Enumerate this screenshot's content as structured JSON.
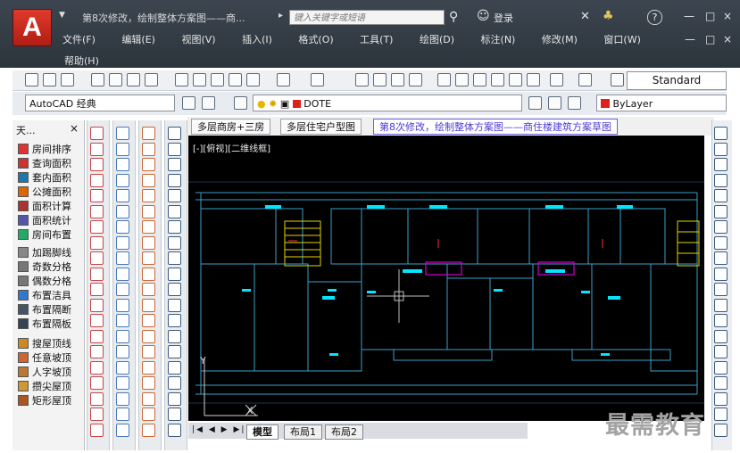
{
  "app": {
    "logo_letter": "A",
    "document_title": "第8次修改，绘制整体方案图——商...",
    "title_arrow": "▸",
    "search_placeholder": "键入关键字或短语",
    "login_label": "登录",
    "help_symbol": "?",
    "window_controls": [
      "—",
      "□",
      "×"
    ],
    "doc_controls": [
      "—",
      "□",
      "×"
    ]
  },
  "menu": {
    "items": [
      "文件(F)",
      "编辑(E)",
      "视图(V)",
      "插入(I)",
      "格式(O)",
      "工具(T)",
      "绘图(D)",
      "标注(N)",
      "修改(M)",
      "窗口(W)"
    ],
    "help": "帮助(H)"
  },
  "toolbar": {
    "text_style": "Standard",
    "workspace": "AutoCAD 经典",
    "layer": "DOTE",
    "color": "ByLayer",
    "layer_color": "#e0201a"
  },
  "side_panel": {
    "title": "天...",
    "close": "×",
    "items": [
      "房间排序",
      "查询面积",
      "套内面积",
      "公摊面积",
      "面积计算",
      "面积统计",
      "房间布置",
      "加踢脚线",
      "奇数分格",
      "偶数分格",
      "布置洁具",
      "布置隔断",
      "布置隔板",
      "搜屋顶线",
      "任意坡顶",
      "人字坡顶",
      "攒尖屋顶",
      "矩形屋顶"
    ],
    "icon_colors": [
      "#d33",
      "#c33",
      "#27a",
      "#d60",
      "#a33",
      "#55a",
      "#2a6",
      "#888",
      "#777",
      "#777",
      "#37c",
      "#456",
      "#345",
      "#c82",
      "#c63",
      "#b73",
      "#c93",
      "#a52"
    ]
  },
  "tabs": {
    "items": [
      "多层商房+三房",
      "多层住宅户型图",
      "第8次修改，绘制整体方案图——商住楼建筑方案草图"
    ],
    "active_index": 2
  },
  "canvas": {
    "viewport_label": "[-][俯视][二维线框]",
    "ucs_y": "Y",
    "ucs_x": "X"
  },
  "layout_tabs": {
    "nav": [
      "|◀",
      "◀",
      "▶",
      "▶|"
    ],
    "items": [
      "模型",
      "布局1",
      "布局2"
    ],
    "active_index": 0
  },
  "watermark": "最需教育"
}
